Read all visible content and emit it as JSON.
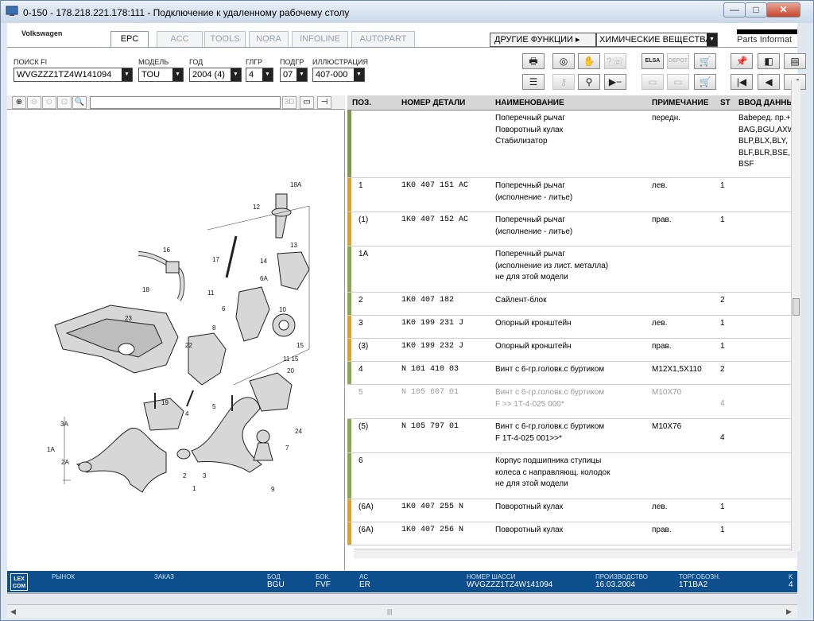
{
  "window": {
    "title": "0-150 - 178.218.221.178:111 - Подключение к удаленному рабочему столу",
    "min": "—",
    "max": "□",
    "close": "✕"
  },
  "brand": {
    "make": "Volkswagen",
    "logo_text": "Parts Informat"
  },
  "tabs": [
    {
      "label": "EPC",
      "active": true
    },
    {
      "label": "ACC",
      "active": false
    },
    {
      "label": "TOOLS",
      "active": false
    },
    {
      "label": "NORA",
      "active": false
    },
    {
      "label": "INFOLINE",
      "active": false
    },
    {
      "label": "AUTOPART",
      "active": false
    }
  ],
  "functions": {
    "other_label": "ДРУГИЕ ФУНКЦИИ ▸",
    "chem_value": "ХИМИЧЕСКИЕ ВЕЩЕСТВА"
  },
  "filters": [
    {
      "label": "ПОИСК FI",
      "value": "WVGZZZ1TZ4W141094"
    },
    {
      "label": "МОДЕЛЬ",
      "value": "TOU"
    },
    {
      "label": "ГОД",
      "value": "2004 (4)"
    },
    {
      "label": "ГЛГР",
      "value": "4"
    },
    {
      "label": "ПОДГР",
      "value": "07"
    },
    {
      "label": "ИЛЛЮСТРАЦИЯ",
      "value": "407-000"
    }
  ],
  "toolbar": {
    "row1": [
      {
        "icon": "print-icon",
        "glyph": "🖶",
        "enabled": true
      },
      {
        "icon": "cd-icon",
        "glyph": "◎",
        "enabled": true
      },
      {
        "icon": "car-hand-icon",
        "glyph": "✋",
        "enabled": true
      },
      {
        "icon": "phone-search-icon",
        "glyph": "?☏",
        "enabled": false
      },
      {
        "icon": "elsa-icon",
        "glyph": "ELSA",
        "enabled": true
      },
      {
        "icon": "depot-icon",
        "glyph": "DEPOT",
        "enabled": false
      },
      {
        "icon": "cart-icon",
        "glyph": "🛒",
        "enabled": true
      },
      {
        "icon": "pin-icon",
        "glyph": "📌",
        "enabled": true
      },
      {
        "icon": "book-back-icon",
        "glyph": "◧",
        "enabled": true
      },
      {
        "icon": "book-icon",
        "glyph": "▤",
        "enabled": true
      }
    ],
    "row2": [
      {
        "icon": "list-icon",
        "glyph": "☰",
        "enabled": true
      },
      {
        "icon": "key-icon",
        "glyph": "⚷",
        "enabled": false
      },
      {
        "icon": "bike-icon",
        "glyph": "⚲",
        "enabled": true
      },
      {
        "icon": "play-minus-icon",
        "glyph": "▶−",
        "enabled": true
      },
      {
        "icon": "doc-icon",
        "glyph": "▭",
        "enabled": false
      },
      {
        "icon": "doc2-icon",
        "glyph": "▭",
        "enabled": false
      },
      {
        "icon": "cart-add-icon",
        "glyph": "🛒",
        "enabled": true
      },
      {
        "icon": "first-icon",
        "glyph": "|◀",
        "enabled": true
      },
      {
        "icon": "prev-icon",
        "glyph": "◀",
        "enabled": true
      },
      {
        "icon": "back-icon",
        "glyph": "◀",
        "enabled": true
      }
    ]
  },
  "viewer_tools": [
    {
      "icon": "zoom-in-icon",
      "glyph": "⊕",
      "enabled": true
    },
    {
      "icon": "zoom-out-icon",
      "glyph": "⊖",
      "enabled": false
    },
    {
      "icon": "zoom-area-icon",
      "glyph": "⊙",
      "enabled": false
    },
    {
      "icon": "zoom-fit-icon",
      "glyph": "⊡",
      "enabled": false
    },
    {
      "icon": "magnifier-icon",
      "glyph": "🔍",
      "enabled": true
    }
  ],
  "viewer_right_tools": [
    {
      "icon": "3d-icon",
      "glyph": "3D",
      "enabled": false
    },
    {
      "icon": "split-icon",
      "glyph": "▭",
      "enabled": true
    },
    {
      "icon": "expand-icon",
      "glyph": "⊣",
      "enabled": true
    }
  ],
  "diagram_labels": [
    "18A",
    "12",
    "13",
    "14",
    "6A",
    "16",
    "17",
    "18",
    "11",
    "10",
    "6",
    "8",
    "23",
    "22",
    "15",
    "11 15",
    "20",
    "19",
    "4",
    "5",
    "3A",
    "1A",
    "2A",
    "3",
    "2",
    "1",
    "24",
    "7",
    "9"
  ],
  "table": {
    "columns": [
      "ПОЗ.",
      "НОМЕР ДЕТАЛИ",
      "НАИМЕНОВАНИЕ",
      "ПРИМЕЧАНИЕ",
      "ST",
      "ВВОД ДАННЫХ"
    ],
    "rows": [
      {
        "pos": "",
        "part": "",
        "name": [
          "Поперечный рычаг",
          "Поворотный кулак",
          "Стабилизатор"
        ],
        "note": "передн.",
        "st": "",
        "data": [
          "Babepeд. пр.+",
          "BAG,BGU,AXW",
          "BLP,BLX,BLY,",
          "BLF,BLR,BSE,",
          "BSF"
        ],
        "mark": "#7f9a47",
        "gray": false,
        "h": 85
      },
      {
        "pos": "1",
        "part": "1K0  407  151  AC",
        "name": [
          "Поперечный рычаг",
          "(исполнение - литье)"
        ],
        "note": "лев.",
        "st": "1",
        "data": [],
        "mark": "#e0a030",
        "gray": false,
        "h": 43
      },
      {
        "pos": "(1)",
        "part": "1K0  407  152  AC",
        "name": [
          "Поперечный рычаг",
          "(исполнение - литье)"
        ],
        "note": "прав.",
        "st": "1",
        "data": [],
        "mark": "#e0a030",
        "gray": false,
        "h": 43
      },
      {
        "pos": "1A",
        "part": "",
        "name": [
          "Поперечный рычаг",
          "(исполнение из лист. металла)",
          "не для этой модели"
        ],
        "note": "",
        "st": "",
        "data": [],
        "mark": "#8aa84e",
        "gray": false,
        "h": 58
      },
      {
        "pos": "2",
        "part": "1K0  407  182",
        "name": [
          "Сайлент-блок"
        ],
        "note": "",
        "st": "2",
        "data": [],
        "mark": "#8aa84e",
        "gray": false,
        "h": 29
      },
      {
        "pos": "3",
        "part": "1K0  199  231  J",
        "name": [
          "Опорный кронштейн"
        ],
        "note": "лев.",
        "st": "1",
        "data": [],
        "mark": "#e0a030",
        "gray": false,
        "h": 29
      },
      {
        "pos": "(3)",
        "part": "1K0  199  232  J",
        "name": [
          "Опорный кронштейн"
        ],
        "note": "прав.",
        "st": "1",
        "data": [],
        "mark": "#e0a030",
        "gray": false,
        "h": 29
      },
      {
        "pos": "4",
        "part": "N     101  410  03",
        "name": [
          "Винт с 6-гр.головк.с буртиком"
        ],
        "note": "M12X1,5X110",
        "st": "2",
        "data": [],
        "mark": "#8aa84e",
        "gray": false,
        "h": 29
      },
      {
        "pos": "5",
        "part": "N     105  607  01",
        "name": [
          "Винт с 6-гр.головк.с буртиком",
          "F             >> 1T-4-025 000*"
        ],
        "note": "M10X70",
        "st": "4",
        "data": [],
        "mark": "",
        "gray": true,
        "h": 43
      },
      {
        "pos": "(5)",
        "part": "N     105  797  01",
        "name": [
          "Винт с 6-гр.головк.с буртиком",
          "F 1T-4-025 001>>*"
        ],
        "note": "M10X76",
        "st": "4",
        "data": [],
        "mark": "#8aa84e",
        "gray": false,
        "h": 43
      },
      {
        "pos": "6",
        "part": "",
        "name": [
          "Корпус подшипника ступицы",
          "колеса с направляющ. колодок",
          "не для этой модели"
        ],
        "note": "",
        "st": "",
        "data": [],
        "mark": "#8aa84e",
        "gray": false,
        "h": 58
      },
      {
        "pos": "(6A)",
        "part": "1K0  407  255  N",
        "name": [
          "Поворотный кулак"
        ],
        "note": "лев.",
        "st": "1",
        "data": [],
        "mark": "#e0a030",
        "gray": false,
        "h": 29
      },
      {
        "pos": "(6A)",
        "part": "1K0  407  256  N",
        "name": [
          "Поворотный кулак"
        ],
        "note": "прав.",
        "st": "1",
        "data": [],
        "mark": "#e0a030",
        "gray": false,
        "h": 29
      }
    ]
  },
  "status": {
    "logo": "LEX COM",
    "fields": [
      {
        "label": "РЫНОК",
        "value": ""
      },
      {
        "label": "ЗАКАЗ",
        "value": ""
      },
      {
        "label": "БОД",
        "value": "BGU"
      },
      {
        "label": "БОК.",
        "value": "FVF"
      },
      {
        "label": "AC",
        "value": "ER"
      },
      {
        "label": "НОМЕР ШАССИ",
        "value": "WVGZZZ1TZ4W141094"
      },
      {
        "label": "ПРОИЗВОДСТВО",
        "value": "16.03.2004"
      },
      {
        "label": "ТОРГ.ОБОЗН.",
        "value": "1T1BA2"
      },
      {
        "label": "K",
        "value": "4"
      }
    ]
  }
}
